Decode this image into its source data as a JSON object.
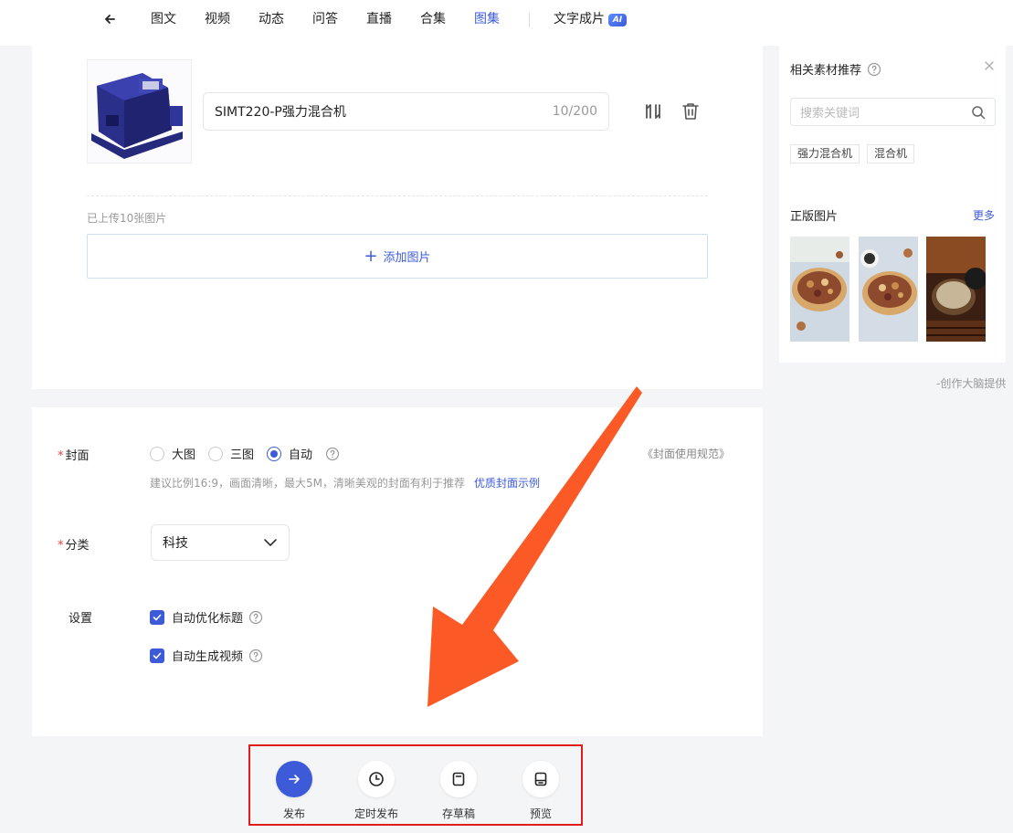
{
  "nav": {
    "items": [
      "图文",
      "视频",
      "动态",
      "问答",
      "直播",
      "合集",
      "图集"
    ],
    "active_index": 6,
    "ai_item": "文字成片",
    "ai_badge": "AI"
  },
  "editor": {
    "title_value": "SIMT220-P强力混合机",
    "title_count": "10/200",
    "uploaded_text": "已上传10张图片",
    "add_image_label": "添加图片"
  },
  "form": {
    "cover": {
      "label": "封面",
      "options": [
        "大图",
        "三图",
        "自动"
      ],
      "selected_index": 2,
      "spec_link": "《封面使用规范》",
      "hint": "建议比例16:9，画面清晰，最大5M，清晰美观的封面有利于推荐",
      "example_link": "优质封面示例"
    },
    "category": {
      "label": "分类",
      "value": "科技"
    },
    "settings": {
      "label": "设置",
      "options": [
        {
          "label": "自动优化标题",
          "checked": true
        },
        {
          "label": "自动生成视频",
          "checked": true
        }
      ]
    }
  },
  "sidebar": {
    "title": "相关素材推荐",
    "search_placeholder": "搜索关键词",
    "tags": [
      "强力混合机",
      "混合机"
    ],
    "section": "正版图片",
    "more": "更多",
    "provided_by": "-创作大脑提供"
  },
  "actions": [
    {
      "label": "发布",
      "icon": "arrow-right-icon"
    },
    {
      "label": "定时发布",
      "icon": "clock-icon"
    },
    {
      "label": "存草稿",
      "icon": "draft-icon"
    },
    {
      "label": "预览",
      "icon": "preview-icon"
    }
  ],
  "colors": {
    "accent": "#3d5bd9",
    "highlight_box": "#e21b1b",
    "arrow": "#fb5a26"
  }
}
